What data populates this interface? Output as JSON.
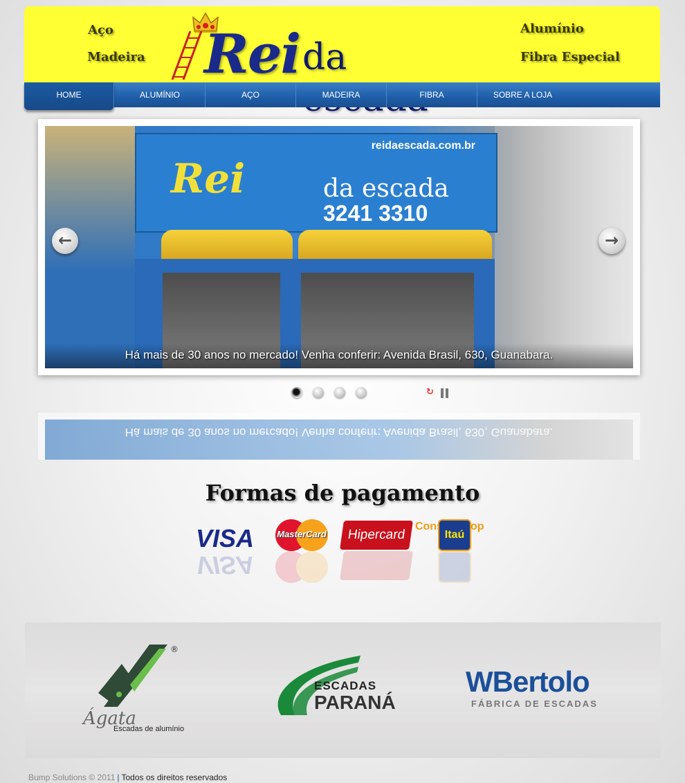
{
  "header": {
    "left_top": "Aço",
    "left_bottom": "Madeira",
    "right_top": "Alumínio",
    "right_bottom": "Fibra Especial",
    "logo_rei": "Rei",
    "logo_da_escada": "da escada"
  },
  "nav": {
    "items": [
      {
        "label": "HOME",
        "active": true
      },
      {
        "label": "ALUMÍNIO",
        "active": false
      },
      {
        "label": "AÇO",
        "active": false
      },
      {
        "label": "MADEIRA",
        "active": false
      },
      {
        "label": "FIBRA",
        "active": false
      },
      {
        "label": "SOBRE A LOJA",
        "active": false
      }
    ]
  },
  "slider": {
    "sign_url": "reidaescada.com.br",
    "sign_rei": "Rei",
    "sign_da_escada": "da escada",
    "sign_phone": "3241 3310",
    "caption": "Há mais de 30 anos no mercado! Venha conferir: Avenida Brasil, 630, Guanabara.",
    "prev_icon": "arrow-left-icon",
    "next_icon": "arrow-right-icon",
    "bullet_count": 4,
    "active_bullet": 1
  },
  "payment": {
    "title": "Formas de pagamento",
    "visa": "VISA",
    "mastercard": "MasterCard",
    "hipercard": "Hipercard",
    "construshop": "Construshop",
    "itau": "Itaú"
  },
  "partners": {
    "agata_name": "Ágata",
    "agata_sub": "Escadas de alumínio",
    "agata_reg": "®",
    "parana_top": "ESCADAS",
    "parana_bottom": "PARANÁ",
    "wbertolo_name": "WBertolo",
    "wbertolo_sub": "FÁBRICA DE ESCADAS"
  },
  "footer": {
    "copyright": "Bump Solutions © 2011",
    "separator": "|",
    "rights": "Todos os direitos reservados"
  },
  "colors": {
    "header_bg": "#ffff33",
    "nav_blue": "#1f5ea8",
    "logo_blue": "#1a2a8a"
  }
}
